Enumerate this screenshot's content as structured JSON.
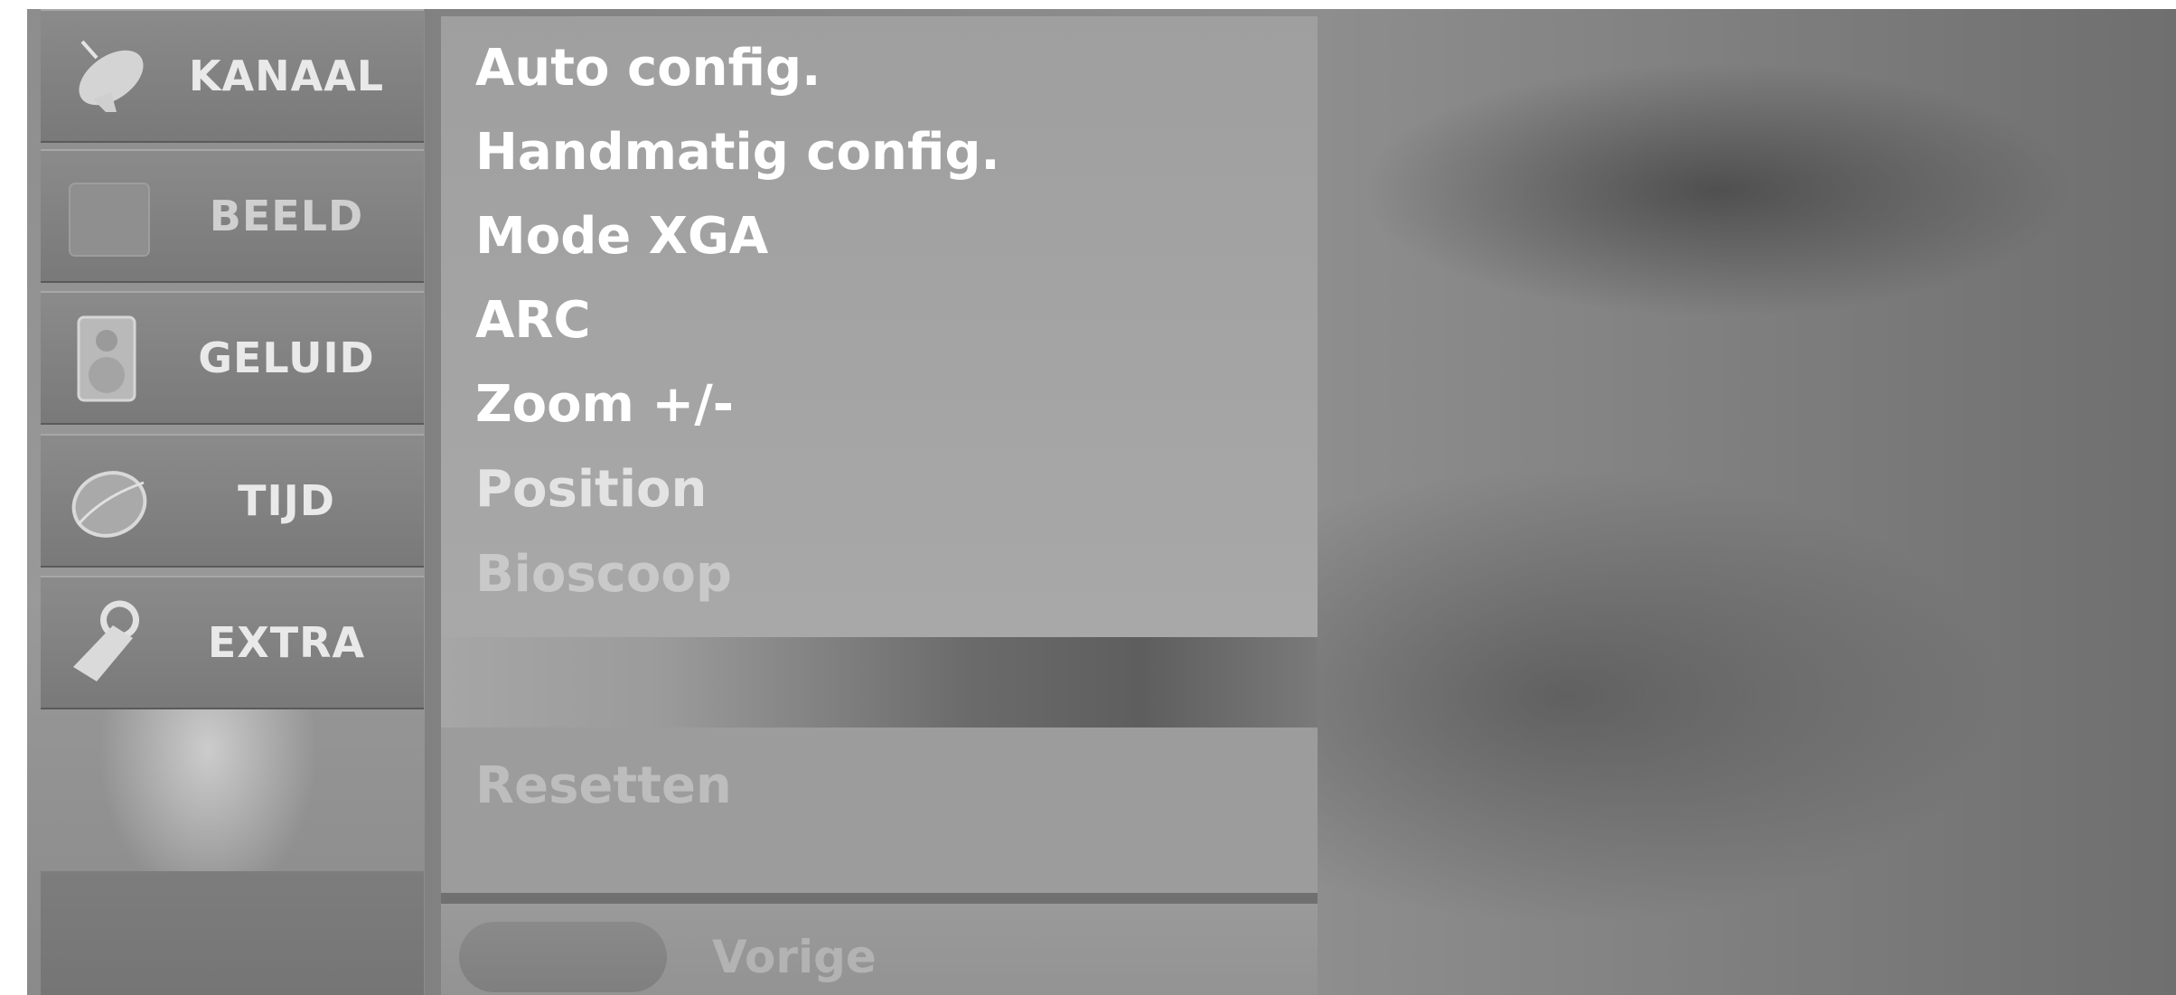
{
  "sidebar": {
    "items": [
      {
        "label": "KANAAL",
        "icon": "satellite-dish-icon"
      },
      {
        "label": "BEELD",
        "icon": "picture-square-icon"
      },
      {
        "label": "GELUID",
        "icon": "speaker-icon"
      },
      {
        "label": "TIJD",
        "icon": "clock-ring-icon"
      },
      {
        "label": "EXTRA",
        "icon": "tag-icon"
      }
    ]
  },
  "submenu": {
    "items": [
      "Auto config.",
      "Handmatig config.",
      "Mode XGA",
      "ARC",
      "Zoom +/-",
      "Position",
      "Bioscoop"
    ],
    "reset_label": "Resetten"
  },
  "footer": {
    "back_label": "Vorige"
  }
}
